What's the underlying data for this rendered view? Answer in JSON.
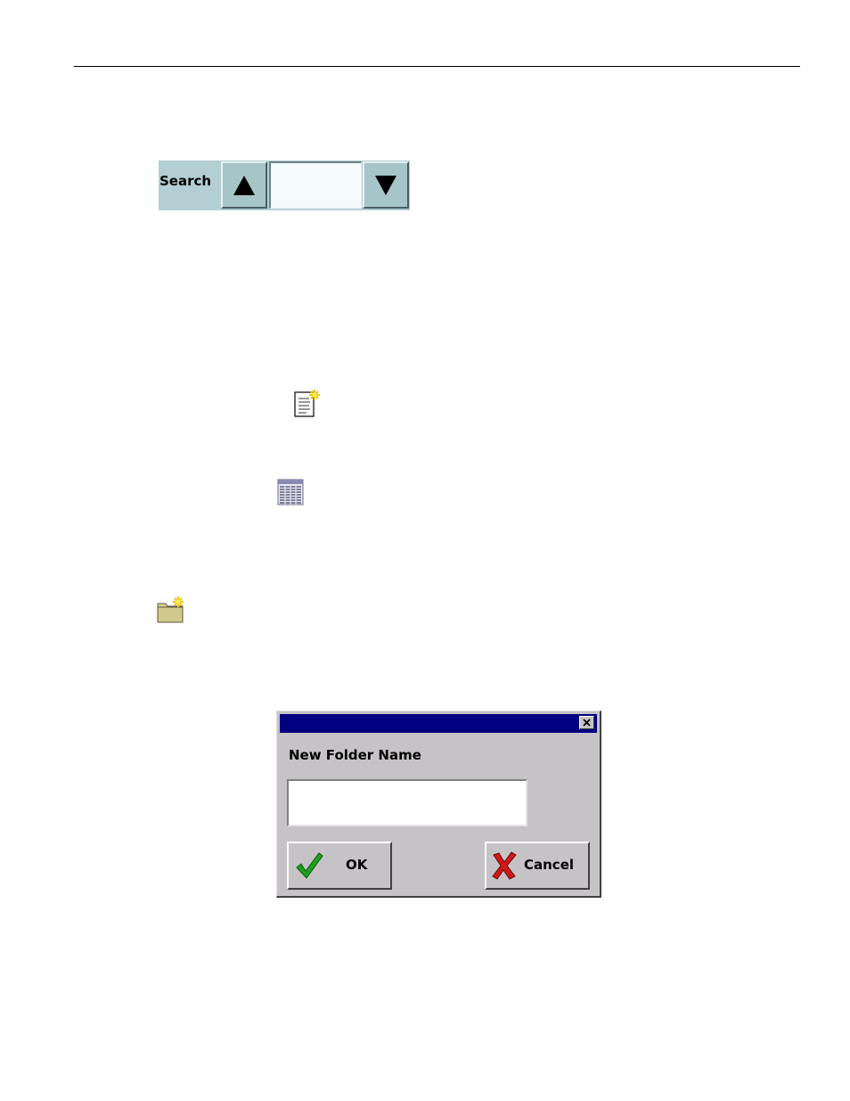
{
  "search": {
    "label": "Search",
    "input_value": "",
    "up_icon": "triangle-up-icon",
    "down_icon": "triangle-down-icon",
    "colors": {
      "panel": "#b4cfd3",
      "field": "#f3fbfc"
    }
  },
  "icons": {
    "new_document": "new-document-icon",
    "table_view": "table-view-icon",
    "new_folder": "new-folder-icon"
  },
  "dialog": {
    "title": "",
    "close_icon": "close-icon",
    "label": "New Folder Name",
    "input_value": "",
    "ok_label": "OK",
    "cancel_label": "Cancel",
    "colors": {
      "titlebar": "#000080",
      "face": "#c6c3c6",
      "ok_check": "#1ea01e",
      "cancel_x": "#d01818"
    }
  }
}
